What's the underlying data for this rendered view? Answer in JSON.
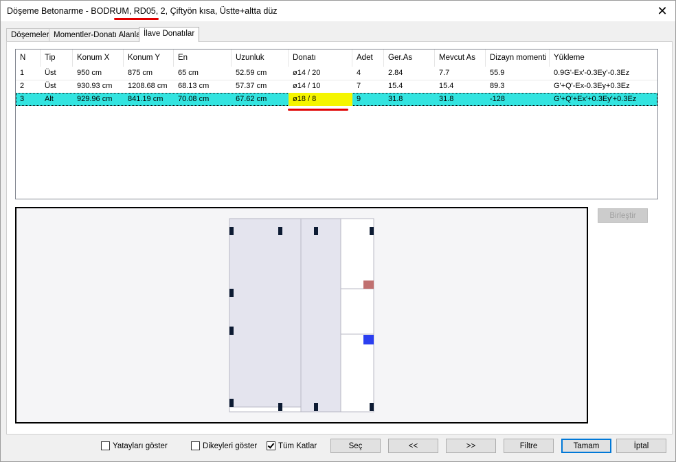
{
  "window": {
    "title": "Döşeme Betonarme - BODRUM, RD05, 2, Çiftyön kısa, Üstte+altta düz",
    "close_glyph": "✕"
  },
  "tabs": [
    {
      "label": "Döşemeler"
    },
    {
      "label": "Momentler-Donatı Alanları"
    },
    {
      "label": "İlave Donatılar"
    }
  ],
  "table": {
    "columns": [
      "N",
      "Tip",
      "Konum X",
      "Konum Y",
      "En",
      "Uzunluk",
      "Donatı",
      "Adet",
      "Ger.As",
      "Mevcut As",
      "Dizayn momenti",
      "Yükleme"
    ],
    "rows": [
      [
        "1",
        "Üst",
        "950 cm",
        "875 cm",
        "65 cm",
        "52.59 cm",
        "ø14 / 20",
        "4",
        "2.84",
        "7.7",
        "55.9",
        "0.9G'-Ex'-0.3Ey'-0.3Ez"
      ],
      [
        "2",
        "Üst",
        "930.93 cm",
        "1208.68 cm",
        "68.13 cm",
        "57.37 cm",
        "ø14 / 10",
        "7",
        "15.4",
        "15.4",
        "89.3",
        "G'+Q'-Ex-0.3Ey+0.3Ez"
      ],
      [
        "3",
        "Alt",
        "929.96 cm",
        "841.19 cm",
        "70.08 cm",
        "67.62 cm",
        "ø18 / 8",
        "9",
        "31.8",
        "31.8",
        "-128",
        "G'+Q'+Ex'+0.3Ey'+0.3Ez"
      ]
    ],
    "selected_row": 3,
    "highlight_color": "#f5f500",
    "selection_color": "#33e4e0"
  },
  "preview": {
    "slab_fill": "#e4e4ee",
    "column_color": "#0d1b33",
    "marker_red": "#c07070",
    "marker_blue": "#2b3ff0"
  },
  "buttons": {
    "birlestir": "Birleştir",
    "sec": "Seç",
    "prev": "<<",
    "next": ">>",
    "filtre": "Filtre",
    "tamam": "Tamam",
    "iptal": "İptal"
  },
  "checkboxes": {
    "yataylari": {
      "label": "Yatayları göster",
      "checked": false
    },
    "dikeyleri": {
      "label": "Dikeyleri göster",
      "checked": false
    },
    "tum_katlar": {
      "label": "Tüm Katlar",
      "checked": true
    }
  }
}
